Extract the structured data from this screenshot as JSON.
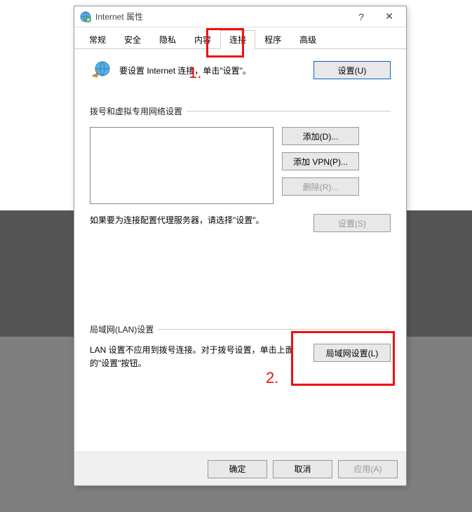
{
  "titlebar": {
    "title": "Internet 属性",
    "help_symbol": "?",
    "close_symbol": "✕"
  },
  "tabs": [
    {
      "label": "常规"
    },
    {
      "label": "安全"
    },
    {
      "label": "隐私"
    },
    {
      "label": "内容"
    },
    {
      "label": "连接",
      "active": true
    },
    {
      "label": "程序"
    },
    {
      "label": "高级"
    }
  ],
  "setup": {
    "text": "要设置 Internet 连接，单击\"设置\"。",
    "button": "设置(U)"
  },
  "dial_section": {
    "title": "拨号和虚拟专用网络设置",
    "buttons": {
      "add": "添加(D)...",
      "add_vpn": "添加 VPN(P)...",
      "remove": "删除(R)..."
    },
    "note_text": "如果要为连接配置代理服务器，请选择\"设置\"。",
    "note_button": "设置(S)"
  },
  "lan_section": {
    "title": "局域网(LAN)设置",
    "text": "LAN 设置不应用到拨号连接。对于拨号设置，单击上面的\"设置\"按钮。",
    "button": "局域网设置(L)"
  },
  "footer": {
    "ok": "确定",
    "cancel": "取消",
    "apply": "应用(A)"
  },
  "annotations": {
    "label1": "1.",
    "label2": "2."
  }
}
